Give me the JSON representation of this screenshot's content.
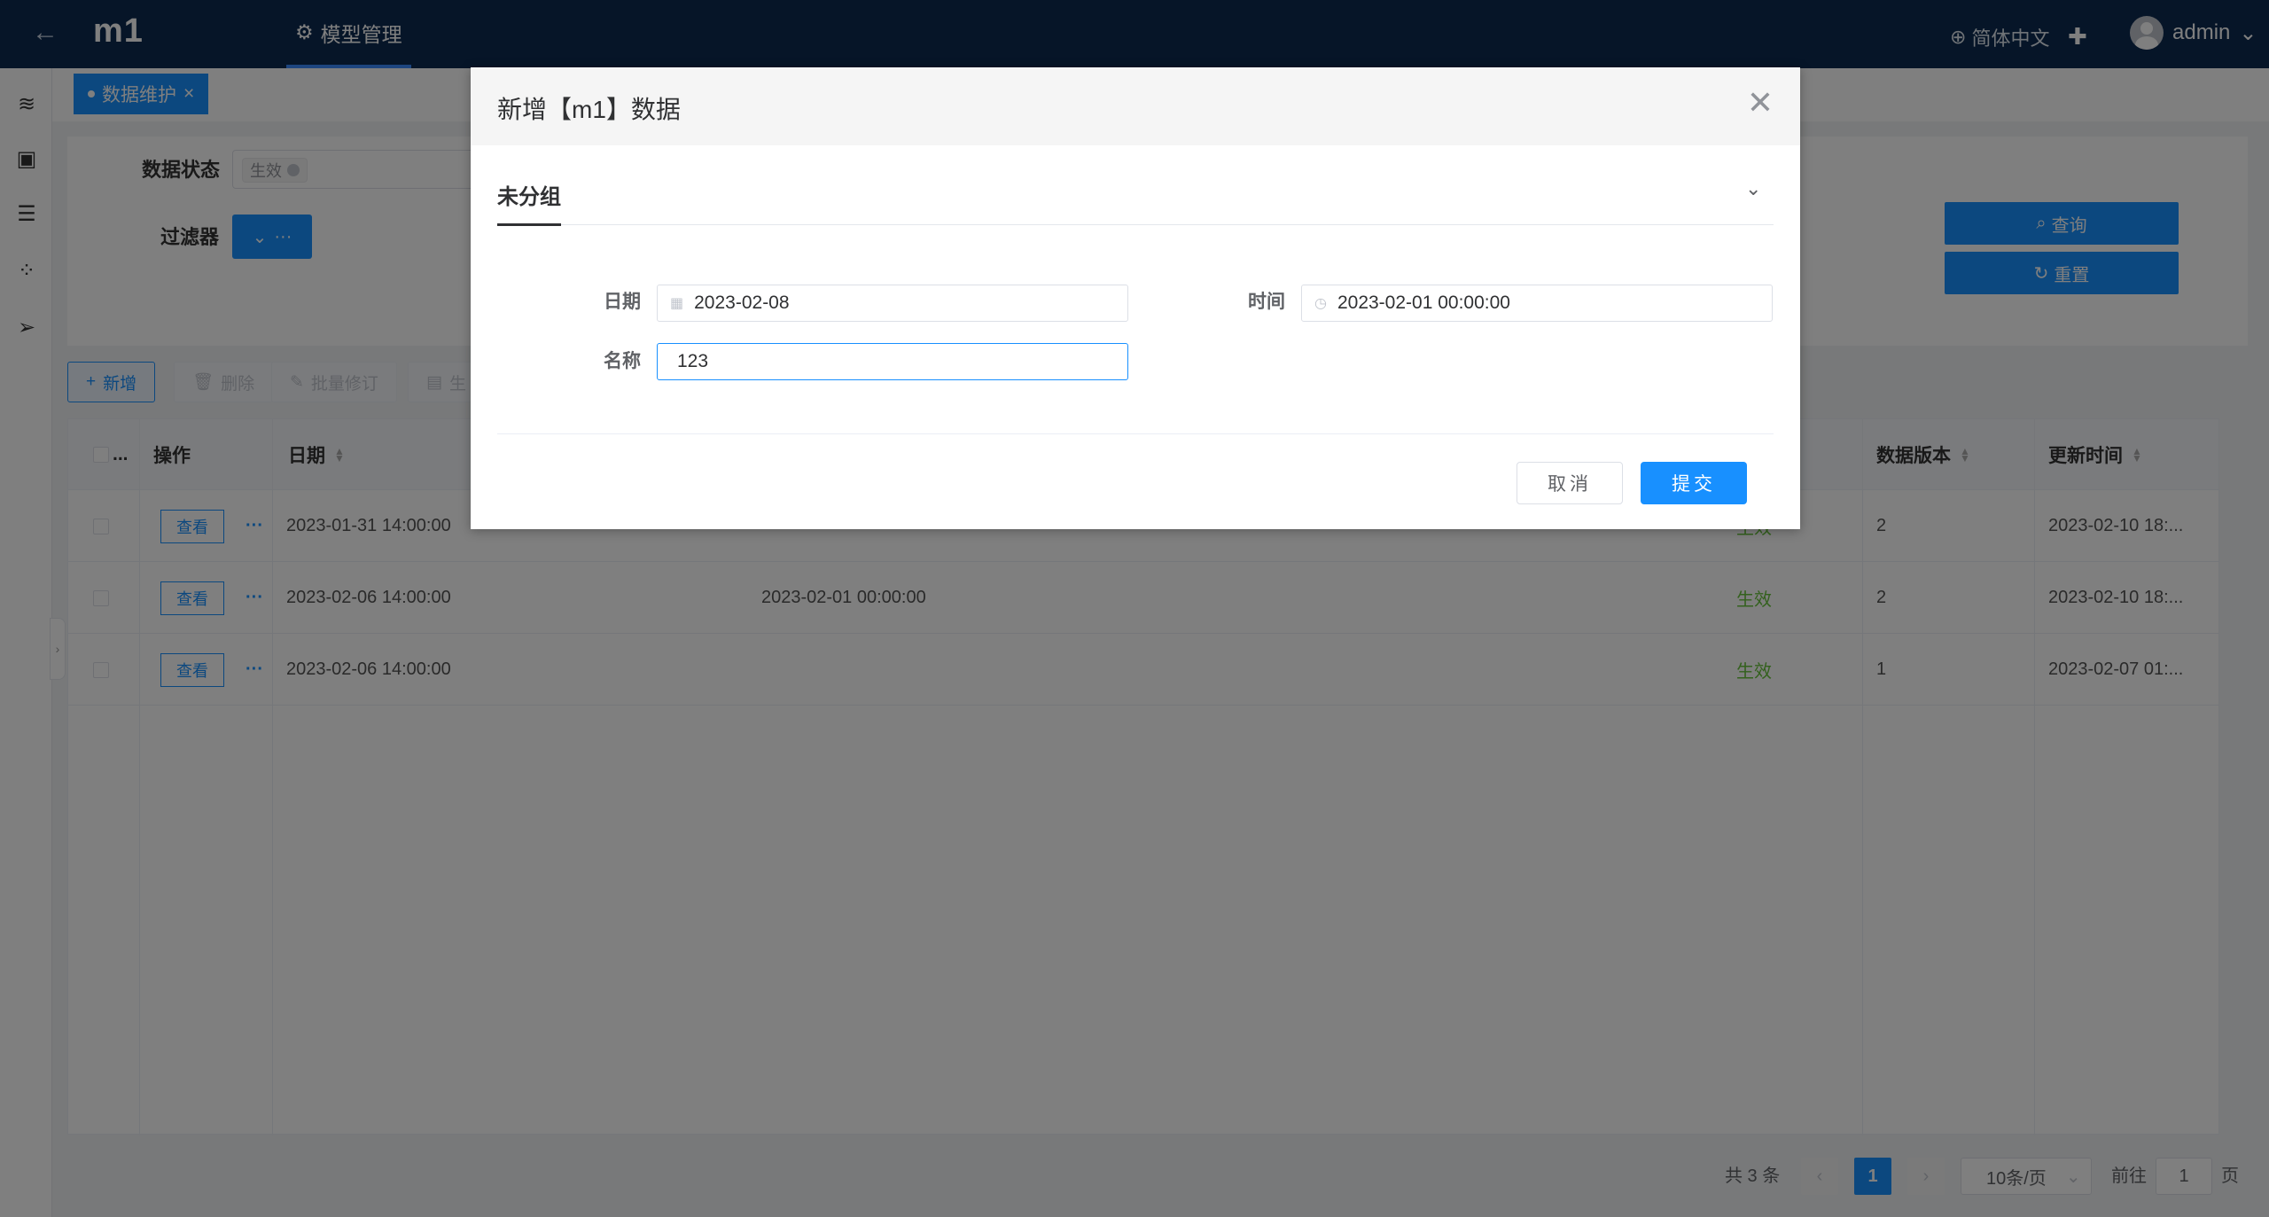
{
  "header": {
    "app_title": "m1",
    "menu_tab": "模型管理",
    "language": "简体中文",
    "user": "admin"
  },
  "tags": {
    "active": "数据维护",
    "close": "×"
  },
  "filter": {
    "status_label": "数据状态",
    "status_value": "生效",
    "filter_label": "过滤器",
    "filter_button": "···",
    "query_button": "查询",
    "reset_button": "重置"
  },
  "toolbar": {
    "add": "新增",
    "delete": "删除",
    "batch_edit": "批量修订",
    "more": "生"
  },
  "table": {
    "columns": {
      "select": "...",
      "actions": "操作",
      "date": "日期",
      "version": "数据版本",
      "updated": "更新时间"
    },
    "view_label": "查看",
    "more_label": "···",
    "rows": [
      {
        "date": "2023-01-31 14:00:00",
        "time": "",
        "status": "生效",
        "version": "2",
        "updated": "2023-02-10 18:..."
      },
      {
        "date": "2023-02-06 14:00:00",
        "time": "2023-02-01 00:00:00",
        "status": "生效",
        "version": "2",
        "updated": "2023-02-10 18:..."
      },
      {
        "date": "2023-02-06 14:00:00",
        "time": "",
        "status": "生效",
        "version": "1",
        "updated": "2023-02-07 01:..."
      }
    ]
  },
  "pagination": {
    "total": "共 3 条",
    "current_page": "1",
    "page_size": "10条/页",
    "goto_label": "前往",
    "goto_value": "1",
    "page_suffix": "页"
  },
  "dialog": {
    "title": "新增【m1】数据",
    "group_title": "未分组",
    "date_label": "日期",
    "date_value": "2023-02-08",
    "time_label": "时间",
    "time_value": "2023-02-01 00:00:00",
    "name_label": "名称",
    "name_value": "123",
    "cancel": "取消",
    "submit": "提交"
  },
  "colors": {
    "header_bg": "#0d2b50",
    "primary": "#1890ff",
    "success": "#67c23a"
  }
}
